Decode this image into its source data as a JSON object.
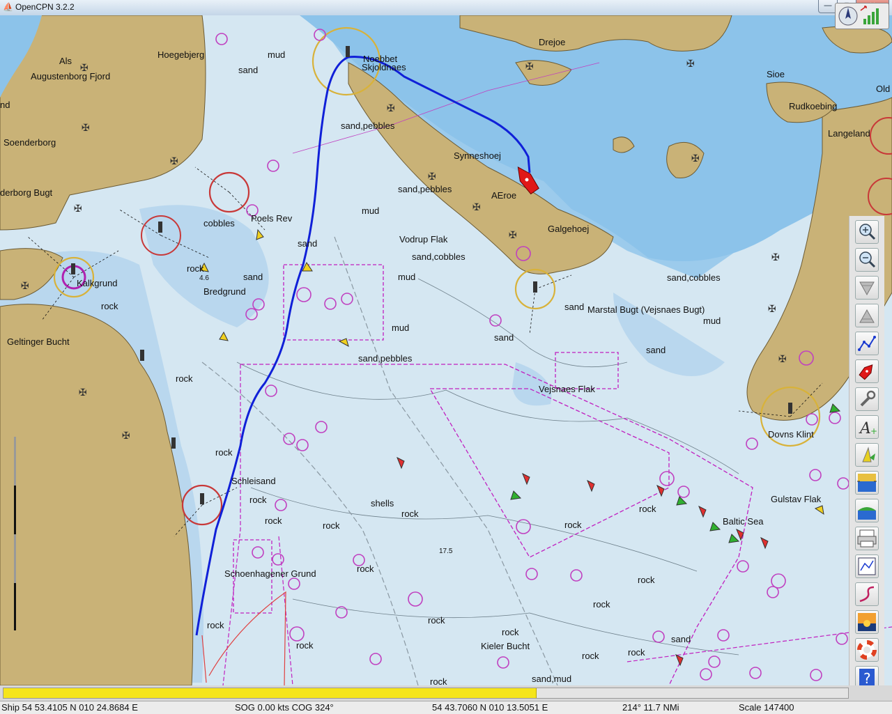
{
  "window": {
    "title": "OpenCPN 3.2.2",
    "minimize": "—",
    "maximize": "▢",
    "close": "✕"
  },
  "chart": {
    "land_color": "#c9b277",
    "deep_water_color": "#d5e7f2",
    "shallow_water_color": "#9ccbec",
    "route_color": "#1020d8",
    "labels": {
      "als": "Als",
      "augustenborg": "Augustenborg Fjord",
      "hoegebjerg": "Hoegebjerg",
      "mud1": "mud",
      "sand1": "sand",
      "nd": "nd",
      "soenderborg": "Soenderborg",
      "derborg": "derborg Bugt",
      "cobbles": "cobbles",
      "poels": "Poels Rev",
      "rock1": "rock",
      "kalkgrund": "Kalkgrund",
      "rock2": "rock",
      "bredgrund": "Bredgrund",
      "sand2": "sand",
      "sand3": "sand",
      "geltinger": "Geltinger Bucht",
      "rock3": "rock",
      "rock4": "rock",
      "schleisand": "Schleisand",
      "rock5": "rock",
      "shells": "shells",
      "rock6": "rock",
      "rock7": "rock",
      "rock8": "rock",
      "schoenhagener": "Schoenhagener Grund",
      "rock9": "rock",
      "rock10": "rock",
      "sandpebbles1": "sand,pebbles",
      "noebbet": "Noebbet",
      "skjolnaes": "Skjoldnaes",
      "drejoe": "Drejoe",
      "sioe": "Sioe",
      "old": "Old",
      "rudkoebing": "Rudkoebing",
      "langeland": "Langeland",
      "synneshoej": "Synneshoej",
      "sandpebbles2": "sand,pebbles",
      "aeroe": "AEroe",
      "mud2": "mud",
      "galgehoej": "Galgehoej",
      "vodrup": "Vodrup Flak",
      "sandcobbles1": "sand,cobbles",
      "mud3": "mud",
      "sandcobbles2": "sand,cobbles",
      "mud4": "mud",
      "sand4": "sand",
      "marstal": "Marstal Bugt (Vejsnaes Bugt)",
      "mud5": "mud",
      "sand5": "sand",
      "sandpebbles3": "sand,pebbles",
      "sand6": "sand",
      "vejsnaes": "Vejsnaes Flak",
      "dovns": "Dovns Klint",
      "gulstav": "Gulstav Flak",
      "rock11": "rock",
      "baltic": "Baltic Sea",
      "rock12": "rock",
      "rock13": "rock",
      "rock14": "rock",
      "rock15": "rock",
      "rock16": "rock",
      "rock17": "rock",
      "kieler": "Kieler Bucht",
      "rock18": "rock",
      "rock19": "rock",
      "sand7": "sand",
      "sandmud": "sand,mud",
      "rock20": "rock",
      "depth1": "4.6",
      "depth2": "17.5"
    }
  },
  "toolbar": {
    "items": [
      {
        "name": "zoom-in-tool",
        "icon": "zoom-in-icon"
      },
      {
        "name": "zoom-out-tool",
        "icon": "zoom-out-icon"
      },
      {
        "name": "scale-down-tool",
        "icon": "scale-down-icon"
      },
      {
        "name": "scale-up-tool",
        "icon": "scale-up-icon"
      },
      {
        "name": "route-tool",
        "icon": "route-icon"
      },
      {
        "name": "follow-ship-tool",
        "icon": "ship-icon"
      },
      {
        "name": "settings-tool",
        "icon": "wrench-icon"
      },
      {
        "name": "text-tool",
        "icon": "text-icon"
      },
      {
        "name": "current-tool",
        "icon": "current-icon"
      },
      {
        "name": "tides-tool",
        "icon": "tide-icon"
      },
      {
        "name": "ais-tool",
        "icon": "ais-icon"
      },
      {
        "name": "print-tool",
        "icon": "print-icon"
      },
      {
        "name": "route-manager-tool",
        "icon": "route-manager-icon"
      },
      {
        "name": "track-tool",
        "icon": "track-icon"
      },
      {
        "name": "color-scheme-tool",
        "icon": "sunset-icon"
      },
      {
        "name": "mob-tool",
        "icon": "lifebuoy-icon"
      },
      {
        "name": "help-tool",
        "icon": "help-icon"
      }
    ]
  },
  "progress": {
    "fraction": 0.63
  },
  "status": {
    "ship": "Ship 54 53.4105 N   010 24.8684 E",
    "sog_cog": "SOG 0.00 kts   COG 324°",
    "cursor": "54 43.7060 N   010 13.5051 E",
    "bearing": "214°  11.7 NMi",
    "scale": "Scale 147400"
  }
}
